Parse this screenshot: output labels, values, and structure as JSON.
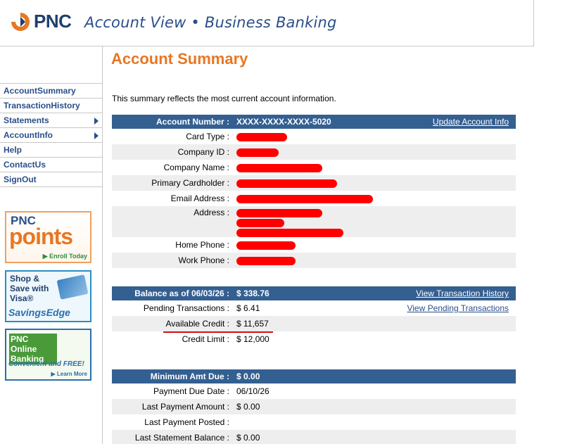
{
  "header": {
    "logo_text": "PNC",
    "title": "Account View • Business Banking"
  },
  "colors": {
    "brand_orange": "#e87722",
    "brand_blue": "#2a4f8a",
    "header_bar": "#345f91",
    "redaction": "#ff0000"
  },
  "sidebar": {
    "items": [
      {
        "label": "AccountSummary",
        "has_arrow": false
      },
      {
        "label": "TransactionHistory",
        "has_arrow": false
      },
      {
        "label": "Statements",
        "has_arrow": true
      },
      {
        "label": "AccountInfo",
        "has_arrow": true
      },
      {
        "label": "Help",
        "has_arrow": false
      },
      {
        "label": "ContactUs",
        "has_arrow": false
      },
      {
        "label": "SignOut",
        "has_arrow": false
      }
    ],
    "promos": {
      "points": {
        "line1": "PNC",
        "line2": "points",
        "cta": "▶ Enroll Today"
      },
      "visa": {
        "line1": "Shop &",
        "line2": "Save with",
        "line3": "Visa®",
        "brand": "SavingsEdge"
      },
      "online": {
        "line1": "PNC Online",
        "line2": "Banking",
        "tagline": "Convenient and FREE!",
        "cta": "▶ Learn More"
      }
    }
  },
  "main": {
    "title": "Account Summary",
    "intro": "This summary reflects the most current account information.",
    "account": {
      "header_label": "Account Number :",
      "header_value": "XXXX-XXXX-XXXX-5020",
      "header_link": "Update Account Info",
      "rows": [
        {
          "label": "Card Type :"
        },
        {
          "label": "Company ID :"
        },
        {
          "label": "Company Name :"
        },
        {
          "label": "Primary Cardholder :"
        },
        {
          "label": "Email Address :"
        },
        {
          "label": "Address :"
        },
        {
          "label": "Home Phone :"
        },
        {
          "label": "Work Phone :"
        }
      ]
    },
    "balance": {
      "header_label": "Balance as of 06/03/26 :",
      "header_value": "$ 338.76",
      "header_link": "View Transaction History",
      "rows": [
        {
          "label": "Pending Transactions :",
          "value": "$ 6.41",
          "link": "View Pending Transactions"
        },
        {
          "label": "Available Credit :",
          "value": "$ 11,657",
          "link": ""
        },
        {
          "label": "Credit Limit :",
          "value": "$ 12,000",
          "link": ""
        }
      ]
    },
    "payment": {
      "header_label": "Minimum Amt Due :",
      "header_value": "$ 0.00",
      "rows": [
        {
          "label": "Payment Due Date :",
          "value": "06/10/26"
        },
        {
          "label": "Last Payment Amount :",
          "value": "$ 0.00"
        },
        {
          "label": "Last Payment Posted :",
          "value": ""
        },
        {
          "label": "Last Statement Balance :",
          "value": "$ 0.00"
        }
      ]
    }
  }
}
